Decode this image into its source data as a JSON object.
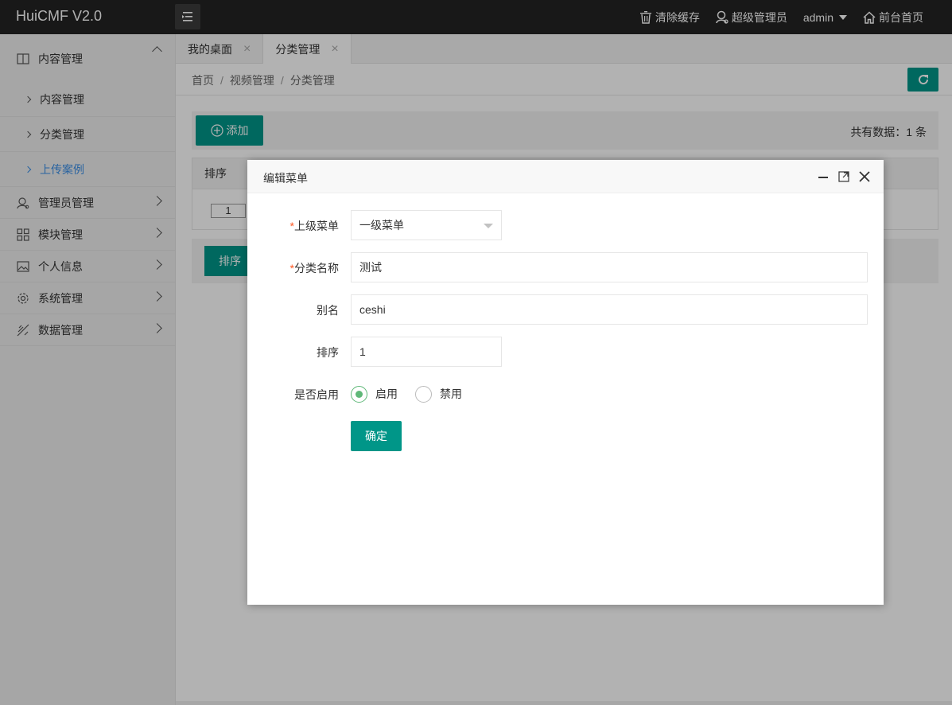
{
  "app": {
    "title": "HuiCMF V2.0"
  },
  "topnav": {
    "clear_cache": "清除缓存",
    "super_admin": "超级管理员",
    "user": "admin",
    "frontend_home": "前台首页"
  },
  "sidebar": {
    "groups": [
      {
        "label": "内容管理",
        "icon": "book-icon",
        "expanded": true
      },
      {
        "label": "管理员管理",
        "icon": "user-icon"
      },
      {
        "label": "模块管理",
        "icon": "grid-icon"
      },
      {
        "label": "个人信息",
        "icon": "image-icon"
      },
      {
        "label": "系统管理",
        "icon": "gear-icon"
      },
      {
        "label": "数据管理",
        "icon": "chart-icon"
      }
    ],
    "subitems": [
      {
        "label": "内容管理"
      },
      {
        "label": "分类管理"
      },
      {
        "label": "上传案例",
        "active": true
      }
    ]
  },
  "tabs": [
    {
      "label": "我的桌面"
    },
    {
      "label": "分类管理",
      "active": true
    }
  ],
  "breadcrumb": [
    "首页",
    "视频管理",
    "分类管理"
  ],
  "toolbar": {
    "add_label": "添加",
    "total_text": "共有数据：1 条"
  },
  "table": {
    "header_sort": "排序",
    "row_sort_value": "1"
  },
  "footer": {
    "sort_button": "排序"
  },
  "modal": {
    "title": "编辑菜单",
    "parent_label": "上级菜单",
    "parent_value": "一级菜单",
    "name_label": "分类名称",
    "name_value": "测试",
    "alias_label": "别名",
    "alias_value": "ceshi",
    "order_label": "排序",
    "order_value": "1",
    "enabled_label": "是否启用",
    "radio_on": "启用",
    "radio_off": "禁用",
    "confirm": "确定",
    "required_mark": "*"
  },
  "colors": {
    "accent": "#009688",
    "topbar": "#232323",
    "radio": "#5fb878",
    "active_link": "#3a8ee6"
  }
}
